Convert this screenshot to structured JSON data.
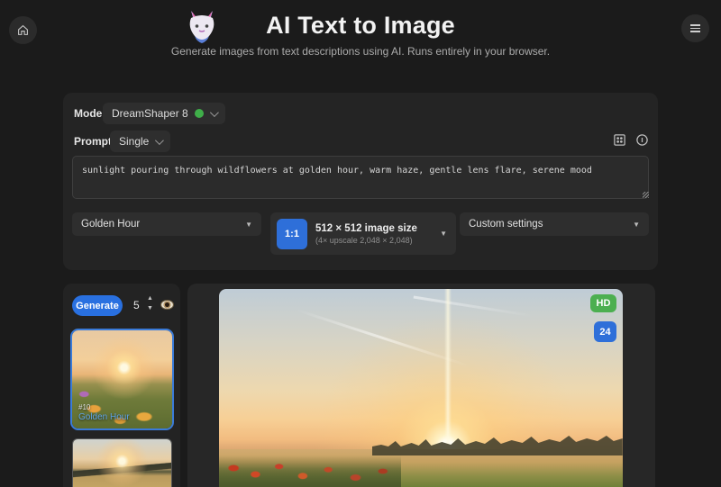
{
  "header": {
    "title": "AI Text to Image",
    "subtitle": "Generate images from text descriptions using AI. Runs entirely in your browser."
  },
  "model": {
    "label": "Model:",
    "value": "DreamShaper 8",
    "status": "online",
    "status_color": "#3fae49"
  },
  "prompt": {
    "label": "Prompt:",
    "mode": "Single",
    "text": "sunlight pouring through wildflowers at golden hour, warm haze, gentle lens flare, serene mood"
  },
  "dropdowns": {
    "style_preset": "Golden Hour",
    "size_ratio": "1:1",
    "size_label": "512 × 512 image size",
    "size_sublabel": "(4× upscale 2,048 × 2,048)",
    "custom": "Custom settings"
  },
  "generate": {
    "button_label": "Generate",
    "count": "5"
  },
  "thumbnails": {
    "selected_id": "#10",
    "selected_label": "Golden Hour"
  },
  "viewer": {
    "hd_badge": "HD",
    "frame_badge": "24"
  },
  "colors": {
    "accent_blue": "#2e6fd9",
    "generate_blue": "#2970e0",
    "hd_green": "#4caf50",
    "selected_border": "#3a7bd9",
    "panel_bg": "#242424",
    "page_bg": "#1b1b1b"
  }
}
